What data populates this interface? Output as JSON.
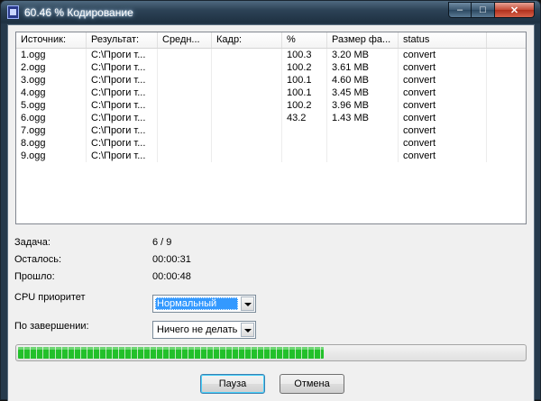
{
  "window": {
    "title": "60.46 % Кодирование"
  },
  "caption": {
    "minimize": "–",
    "maximize": "□",
    "close": "✕"
  },
  "columns": [
    "Источник:",
    "Результат:",
    "Средн...",
    "Кадр:",
    "%",
    "Размер фа...",
    "status"
  ],
  "rows": [
    [
      "1.ogg",
      "C:\\Проги т...",
      "",
      "",
      "100.3",
      "3.20 MB",
      "convert"
    ],
    [
      "2.ogg",
      "C:\\Проги т...",
      "",
      "",
      "100.2",
      "3.61 MB",
      "convert"
    ],
    [
      "3.ogg",
      "C:\\Проги т...",
      "",
      "",
      "100.1",
      "4.60 MB",
      "convert"
    ],
    [
      "4.ogg",
      "C:\\Проги т...",
      "",
      "",
      "100.1",
      "3.45 MB",
      "convert"
    ],
    [
      "5.ogg",
      "C:\\Проги т...",
      "",
      "",
      "100.2",
      "3.96 MB",
      "convert"
    ],
    [
      "6.ogg",
      "C:\\Проги т...",
      "",
      "",
      "43.2",
      "1.43 MB",
      "convert"
    ],
    [
      "7.ogg",
      "C:\\Проги т...",
      "",
      "",
      "",
      "",
      "convert"
    ],
    [
      "8.ogg",
      "C:\\Проги т...",
      "",
      "",
      "",
      "",
      "convert"
    ],
    [
      "9.ogg",
      "C:\\Проги т...",
      "",
      "",
      "",
      "",
      "convert"
    ]
  ],
  "info": {
    "task_label": "Задача:",
    "task_value": "6 / 9",
    "remaining_label": "Осталось:",
    "remaining_value": "00:00:31",
    "elapsed_label": "Прошло:",
    "elapsed_value": "00:00:48"
  },
  "priority": {
    "label": "CPU приоритет",
    "value": "Нормальный"
  },
  "on_finish": {
    "label": "По завершении:",
    "value": "Ничего не делать"
  },
  "progress": {
    "percent": 60.46,
    "color": "#22c02a"
  },
  "buttons": {
    "pause": "Пауза",
    "cancel": "Отмена"
  }
}
